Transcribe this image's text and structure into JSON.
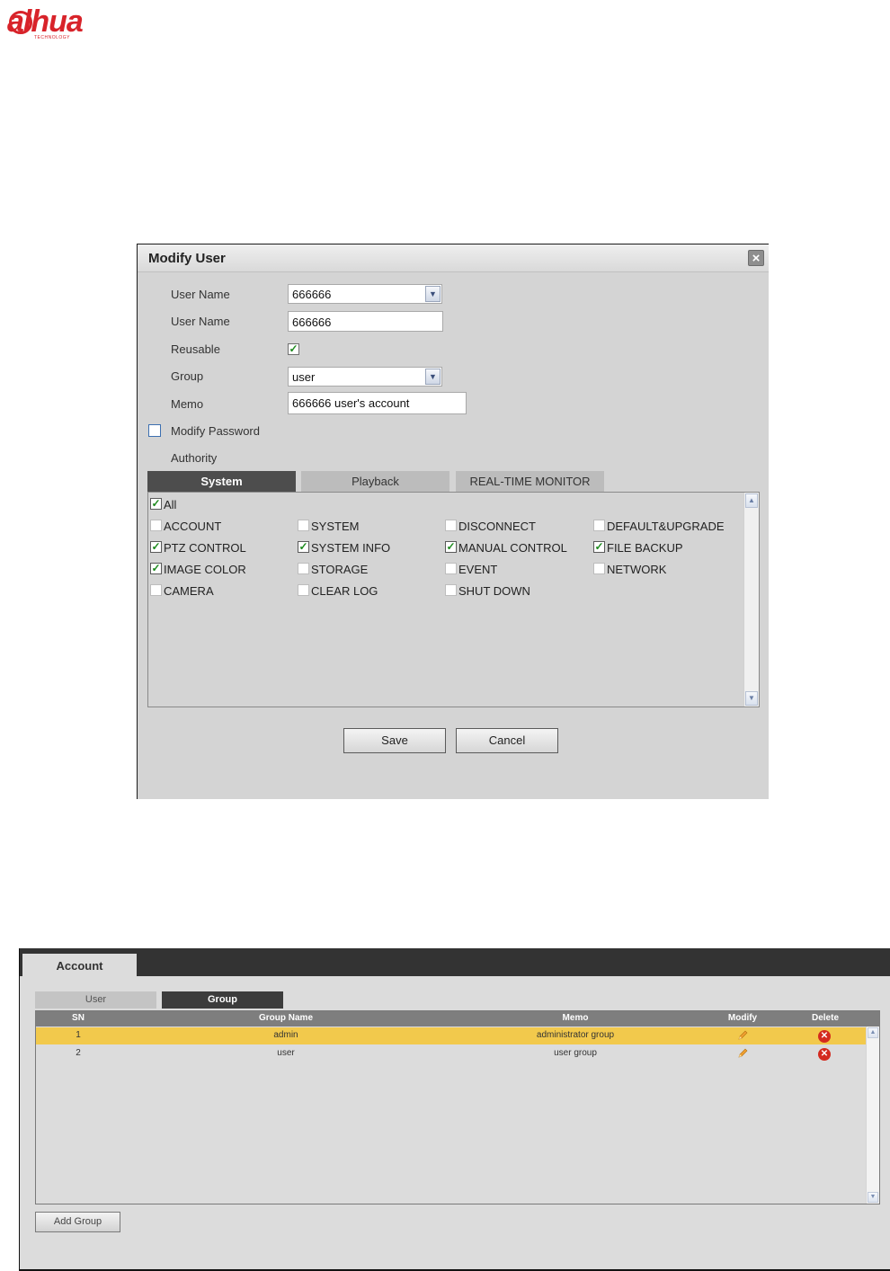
{
  "logo": {
    "brand": "alhua",
    "tagline": "TECHNOLOGY",
    "color": "#d8232a"
  },
  "dialog": {
    "title": "Modify User",
    "close_label": "×",
    "fields": {
      "user_name_label": "User Name",
      "user_name_value": "666666",
      "user_name2_label": "User Name",
      "user_name2_value": "666666",
      "reusable_label": "Reusable",
      "reusable_checked": true,
      "group_label": "Group",
      "group_value": "user",
      "memo_label": "Memo",
      "memo_value": "666666 user's account",
      "modify_password_label": "Modify Password",
      "modify_password_checked": false,
      "authority_label": "Authority"
    },
    "tabs": [
      {
        "label": "System",
        "active": true
      },
      {
        "label": "Playback",
        "active": false
      },
      {
        "label": "REAL-TIME MONITOR",
        "active": false
      }
    ],
    "permissions": {
      "all": {
        "label": "All",
        "checked": true
      },
      "items": [
        {
          "label": "ACCOUNT",
          "checked": false
        },
        {
          "label": "SYSTEM",
          "checked": false
        },
        {
          "label": "DISCONNECT",
          "checked": false
        },
        {
          "label": "DEFAULT&UPGRADE",
          "checked": false
        },
        {
          "label": "PTZ CONTROL",
          "checked": true
        },
        {
          "label": "SYSTEM INFO",
          "checked": true
        },
        {
          "label": "MANUAL CONTROL",
          "checked": true
        },
        {
          "label": "FILE BACKUP",
          "checked": true
        },
        {
          "label": "IMAGE COLOR",
          "checked": true
        },
        {
          "label": "STORAGE",
          "checked": false
        },
        {
          "label": "EVENT",
          "checked": false
        },
        {
          "label": "NETWORK",
          "checked": false
        },
        {
          "label": "CAMERA",
          "checked": false
        },
        {
          "label": "CLEAR LOG",
          "checked": false
        },
        {
          "label": "SHUT DOWN",
          "checked": false
        }
      ]
    },
    "buttons": {
      "save": "Save",
      "cancel": "Cancel"
    }
  },
  "account": {
    "title": "Account",
    "subtabs": {
      "user": "User",
      "group": "Group"
    },
    "columns": {
      "sn": "SN",
      "group_name": "Group Name",
      "memo": "Memo",
      "modify": "Modify",
      "delete": "Delete"
    },
    "rows": [
      {
        "sn": "1",
        "group_name": "admin",
        "memo": "administrator group",
        "selected": true
      },
      {
        "sn": "2",
        "group_name": "user",
        "memo": "user group",
        "selected": false
      }
    ],
    "add_button": "Add Group",
    "highlight_color": "#f2c94c"
  }
}
